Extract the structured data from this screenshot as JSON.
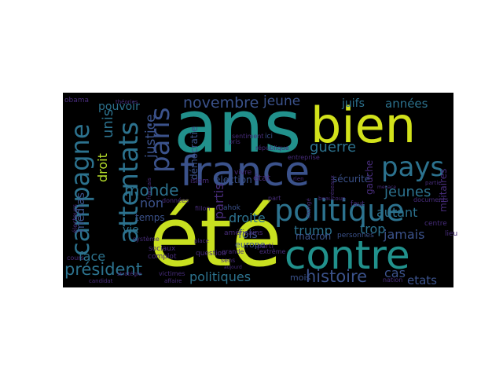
{
  "figure": {
    "type": "wordcloud",
    "background_color": "#000000",
    "palette": [
      "#440154",
      "#472c7a",
      "#3b528b",
      "#2c728e",
      "#21918c",
      "#28ae80",
      "#5ec962",
      "#addc30",
      "#fde725"
    ],
    "words": [
      {
        "text": "ans",
        "color": "#21918c"
      },
      {
        "text": "bien",
        "color": "#d2e21b"
      },
      {
        "text": "été",
        "color": "#c8e020"
      },
      {
        "text": "france",
        "color": "#3b528b"
      },
      {
        "text": "contre",
        "color": "#21918c"
      },
      {
        "text": "politique",
        "color": "#2c728e"
      },
      {
        "text": "paris",
        "color": "#3b528b"
      },
      {
        "text": "attentats",
        "color": "#2c728e"
      },
      {
        "text": "campagne",
        "color": "#2c728e"
      },
      {
        "text": "pays",
        "color": "#2c728e"
      },
      {
        "text": "novembre",
        "color": "#3b528b"
      },
      {
        "text": "guerre",
        "color": "#2c728e"
      },
      {
        "text": "président",
        "color": "#2c728e"
      },
      {
        "text": "histoire",
        "color": "#3b528b"
      },
      {
        "text": "monde",
        "color": "#2c728e"
      },
      {
        "text": "jeunes",
        "color": "#2c728e"
      },
      {
        "text": "jeune",
        "color": "#3b528b"
      },
      {
        "text": "unis",
        "color": "#2c728e"
      },
      {
        "text": "justice",
        "color": "#3b528b"
      },
      {
        "text": "non",
        "color": "#3b528b"
      },
      {
        "text": "droite",
        "color": "#2c728e"
      },
      {
        "text": "droit",
        "color": "#b5de2b"
      },
      {
        "text": "partis",
        "color": "#472c7a"
      },
      {
        "text": "trump",
        "color": "#2c728e"
      },
      {
        "text": "trop",
        "color": "#2c728e"
      },
      {
        "text": "autant",
        "color": "#2c728e"
      },
      {
        "text": "jamais",
        "color": "#3b528b"
      },
      {
        "text": "années",
        "color": "#2c728e"
      },
      {
        "text": "cas",
        "color": "#3b528b"
      },
      {
        "text": "etats",
        "color": "#3b528b"
      },
      {
        "text": "politiques",
        "color": "#2c728e"
      },
      {
        "text": "face",
        "color": "#2c728e"
      },
      {
        "text": "vie",
        "color": "#2c728e"
      },
      {
        "text": "fois",
        "color": "#3b528b"
      },
      {
        "text": "médias",
        "color": "#3b528b"
      },
      {
        "text": "pouvoir",
        "color": "#2c728e"
      },
      {
        "text": "juifs",
        "color": "#2c728e"
      },
      {
        "text": "temps",
        "color": "#3b528b"
      },
      {
        "text": "macron",
        "color": "#3b528b"
      },
      {
        "text": "démocratie",
        "color": "#3b528b"
      },
      {
        "text": "élection",
        "color": "#3b528b"
      },
      {
        "text": "état",
        "color": "#472c7a"
      },
      {
        "text": "sécurité",
        "color": "#3b528b"
      },
      {
        "text": "militaires",
        "color": "#472c7a"
      },
      {
        "text": "gauche",
        "color": "#472c7a"
      },
      {
        "text": "europe",
        "color": "#3b528b"
      },
      {
        "text": "mois",
        "color": "#3b528b"
      },
      {
        "text": "obama",
        "color": "#472c7a"
      },
      {
        "text": "théories",
        "color": "#472c7a"
      },
      {
        "text": "ici",
        "color": "#3b528b"
      },
      {
        "text": "vivre",
        "color": "#472c7a"
      },
      {
        "text": "islam",
        "color": "#472c7a"
      },
      {
        "text": "américains",
        "color": "#472c7a"
      },
      {
        "text": "ahok",
        "color": "#3b528b"
      },
      {
        "text": "parti",
        "color": "#472c7a"
      },
      {
        "text": "république",
        "color": "#472c7a"
      },
      {
        "text": "sentiment",
        "color": "#472c7a"
      },
      {
        "text": "entreprise",
        "color": "#472c7a"
      },
      {
        "text": "personnes",
        "color": "#3b528b"
      },
      {
        "text": "question",
        "color": "#472c7a"
      },
      {
        "text": "sociaux",
        "color": "#472c7a"
      },
      {
        "text": "complot",
        "color": "#472c7a"
      },
      {
        "text": "cours",
        "color": "#472c7a"
      },
      {
        "text": "stratégie",
        "color": "#472c7a"
      },
      {
        "text": "victimes",
        "color": "#472c7a"
      },
      {
        "text": "affaire",
        "color": "#472c7a"
      },
      {
        "text": "nation",
        "color": "#472c7a"
      },
      {
        "text": "centre",
        "color": "#472c7a"
      },
      {
        "text": "lieu",
        "color": "#472c7a"
      },
      {
        "text": "données",
        "color": "#472c7a"
      },
      {
        "text": "système",
        "color": "#472c7a"
      },
      {
        "text": "documents",
        "color": "#472c7a"
      },
      {
        "text": "faut",
        "color": "#472c7a"
      },
      {
        "text": "part",
        "color": "#472c7a"
      },
      {
        "text": "grande",
        "color": "#472c7a"
      },
      {
        "text": "sens",
        "color": "#472c7a"
      },
      {
        "text": "extrême",
        "color": "#472c7a"
      },
      {
        "text": "place",
        "color": "#472c7a"
      },
      {
        "text": "fillon",
        "color": "#472c7a"
      },
      {
        "text": "électeurs",
        "color": "#472c7a"
      },
      {
        "text": "français",
        "color": "#472c7a"
      },
      {
        "text": "candidat",
        "color": "#472c7a"
      },
      {
        "text": "pris",
        "color": "#472c7a"
      },
      {
        "text": "changé",
        "color": "#472c7a"
      },
      {
        "text": "beaucoup",
        "color": "#472c7a"
      },
      {
        "text": "rien",
        "color": "#472c7a"
      },
      {
        "text": "aujourd",
        "color": "#472c7a"
      },
      {
        "text": "réseaux",
        "color": "#472c7a"
      },
      {
        "text": "menace",
        "color": "#472c7a"
      },
      {
        "text": "partie",
        "color": "#472c7a"
      }
    ]
  }
}
